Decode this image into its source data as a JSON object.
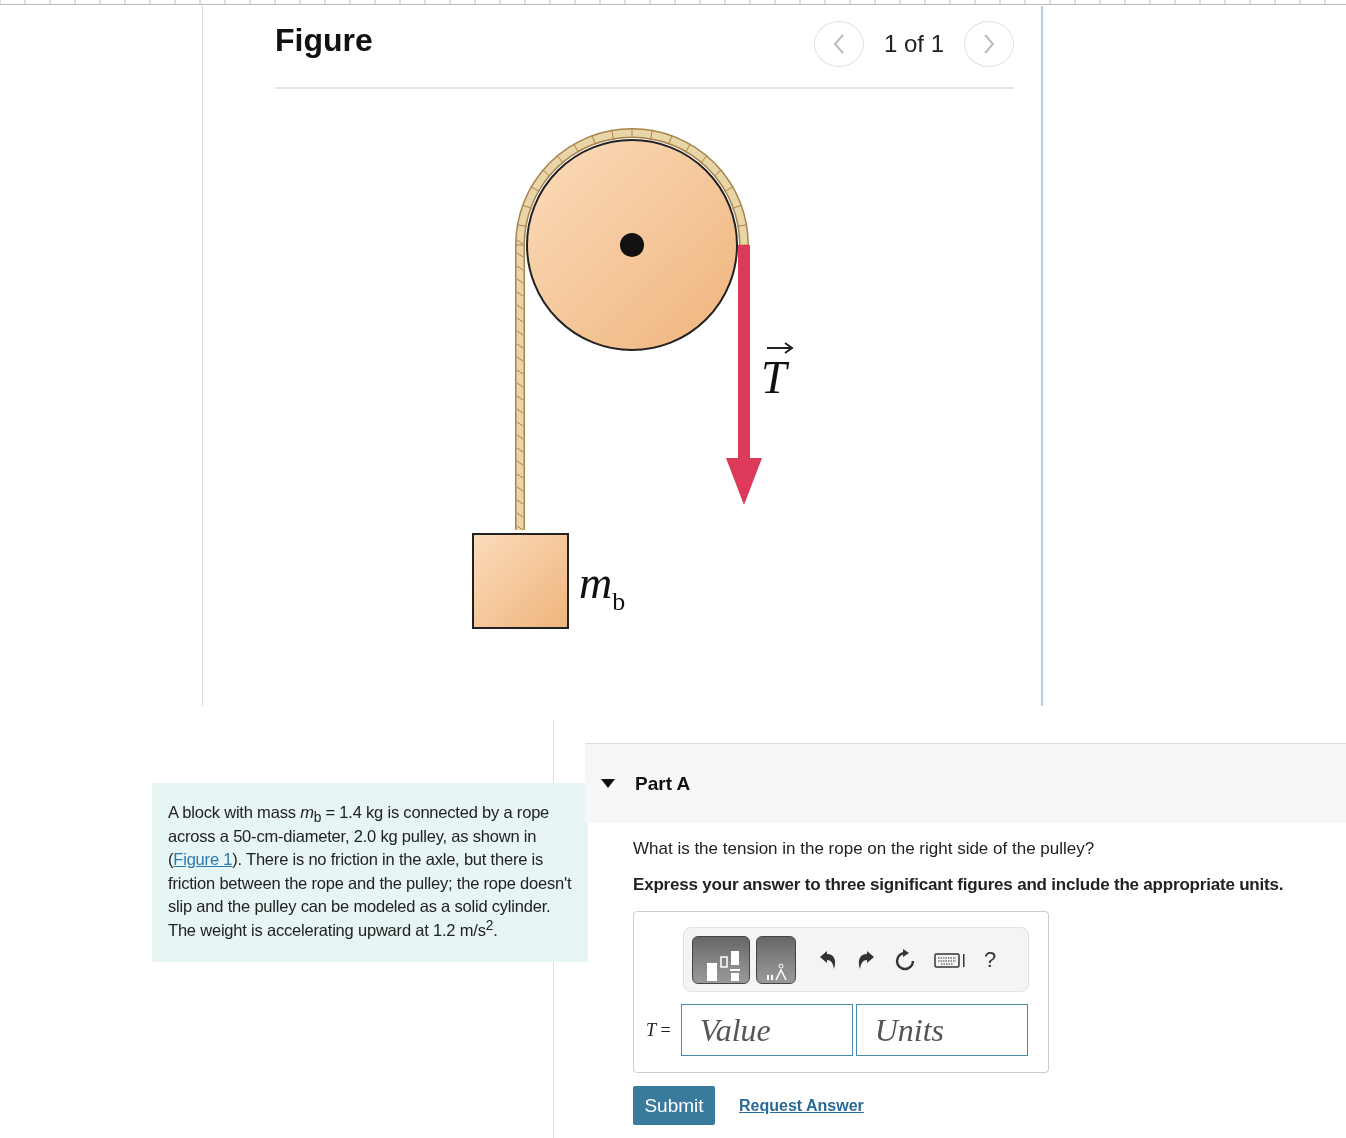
{
  "figure": {
    "title": "Figure",
    "pager": "1 of 1",
    "prev_disabled": true,
    "next_disabled": true,
    "labels": {
      "mass": "m$_{b}$",
      "tension": "T"
    }
  },
  "problem": {
    "text_before": "A block with mass *m*$_{b}$ = 1.4 kg is connected by a rope across a 50-cm-diameter, 2.0 kg pulley, as shown in (",
    "link": "Figure 1",
    "text_after": "). There is no friction in the axle, but there is friction between the rope and the pulley; the rope doesn't slip and the pulley can be modeled as a solid cylinder. The weight is accelerating upward at 1.2 m/s$^{2}$."
  },
  "part": {
    "title": "Part A",
    "expanded": true,
    "question": "What is the tension in the rope on the right side of the pulley?",
    "instruction": "Express your answer to three significant figures and include the appropriate units.",
    "toolbar": {
      "help": "?"
    },
    "variable": "T",
    "equals": "=",
    "value_placeholder": "Value",
    "units_placeholder": "Units",
    "submit": "Submit",
    "request": "Request Answer"
  }
}
